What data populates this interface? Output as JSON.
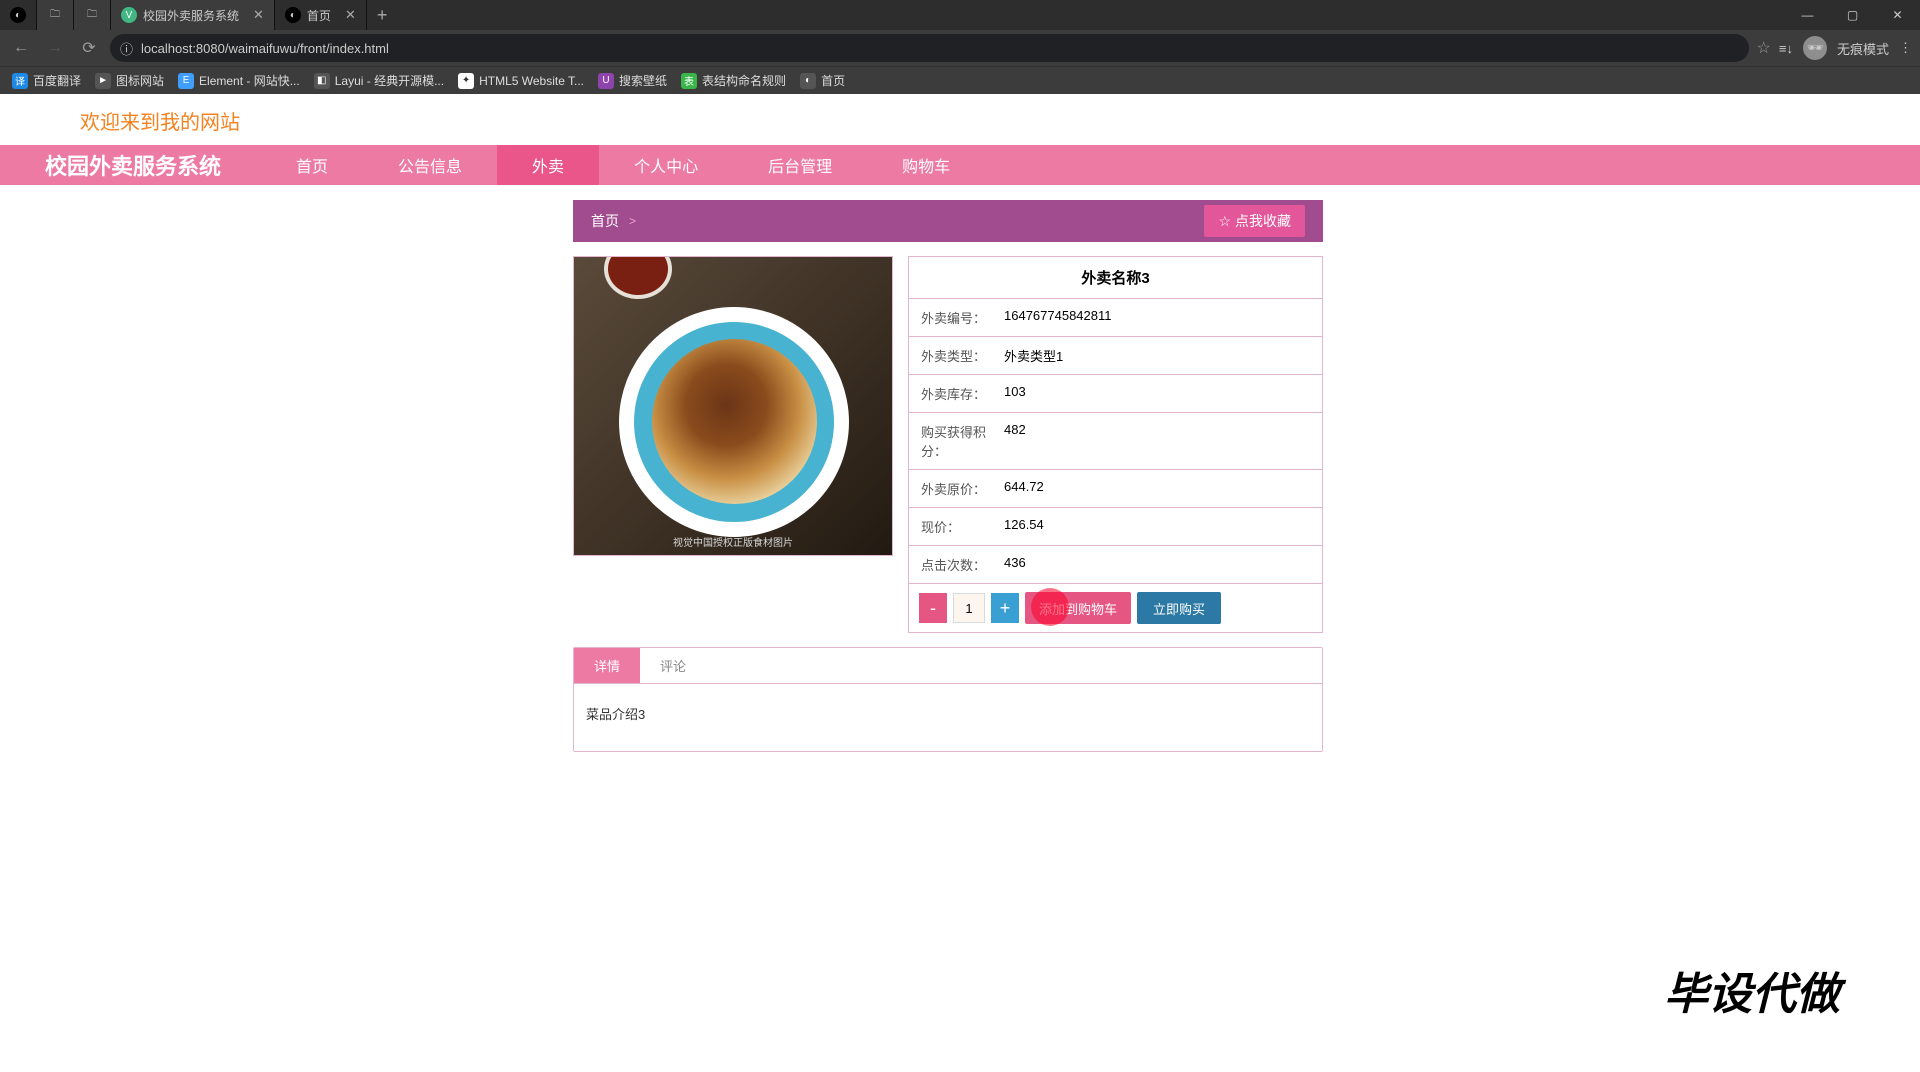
{
  "browser": {
    "tabs": [
      {
        "title": "校园外卖服务系统",
        "fav": "V"
      },
      {
        "title": "首页",
        "fav": "◐"
      }
    ],
    "url": "localhost:8080/waimaifuwu/front/index.html",
    "incognito": "无痕模式"
  },
  "bookmarks": [
    {
      "label": "百度翻译"
    },
    {
      "label": "图标网站"
    },
    {
      "label": "Element - 网站快..."
    },
    {
      "label": "Layui - 经典开源模..."
    },
    {
      "label": "HTML5 Website T..."
    },
    {
      "label": "搜索壁纸"
    },
    {
      "label": "表结构命名规则"
    },
    {
      "label": "首页"
    }
  ],
  "page": {
    "welcome": "欢迎来到我的网站",
    "brand": "校园外卖服务系统",
    "nav": [
      {
        "label": "首页"
      },
      {
        "label": "公告信息"
      },
      {
        "label": "外卖",
        "active": true
      },
      {
        "label": "个人中心"
      },
      {
        "label": "后台管理"
      },
      {
        "label": "购物车"
      }
    ],
    "crumb": {
      "home": "首页",
      "sep": ">",
      "current": ""
    },
    "fav_btn": "点我收藏",
    "product": {
      "title": "外卖名称3",
      "rows": [
        {
          "k": "外卖编号：",
          "v": "164767745842811"
        },
        {
          "k": "外卖类型：",
          "v": "外卖类型1"
        },
        {
          "k": "外卖库存：",
          "v": "103"
        },
        {
          "k": "购买获得积分：",
          "v": "482"
        },
        {
          "k": "外卖原价：",
          "v": "644.72"
        },
        {
          "k": "现价：",
          "v": "126.54"
        },
        {
          "k": "点击次数：",
          "v": "436"
        }
      ],
      "qty": "1",
      "minus": "-",
      "plus": "+",
      "add_cart": "添加到购物车",
      "buy_now": "立即购买",
      "img_caption": "视觉中国授权正版食材图片"
    },
    "tabs": {
      "detail": "详情",
      "comment": "评论",
      "detail_body": "菜品介绍3"
    },
    "watermark": "毕设代做"
  }
}
